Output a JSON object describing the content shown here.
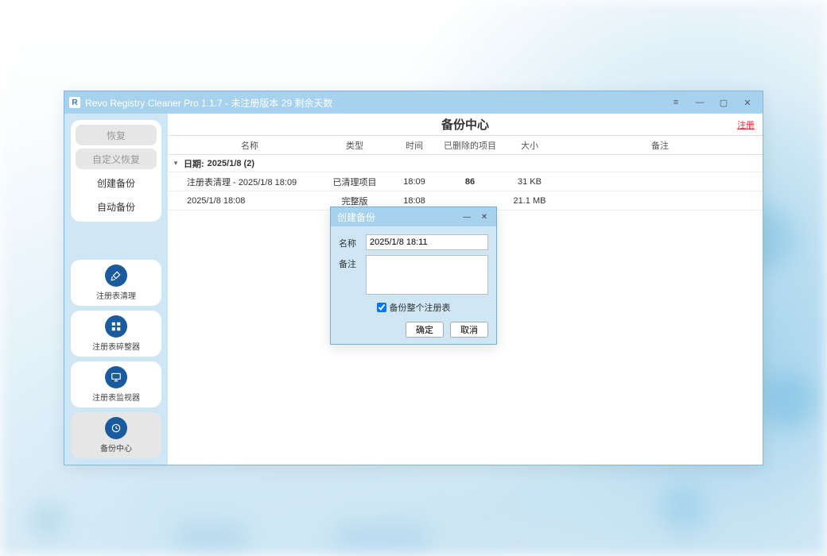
{
  "window": {
    "title": "Revo Registry Cleaner Pro 1.1.7 - 未注册版本 29 剩余天数"
  },
  "sidebar_top": {
    "restore": "恢复",
    "custom_restore": "自定义恢复",
    "create_backup": "创建备份",
    "auto_backup": "自动备份"
  },
  "nav": {
    "cleaner": "注册表清理",
    "defrag": "注册表碎整器",
    "monitor": "注册表监视器",
    "backup": "备份中心"
  },
  "main": {
    "title": "备份中心",
    "register": "注册"
  },
  "columns": {
    "name": "名称",
    "type": "类型",
    "time": "时间",
    "deleted": "已删除的项目",
    "size": "大小",
    "note": "备注"
  },
  "group": {
    "label_prefix": "日期:",
    "label_value": "2025/1/8  (2)"
  },
  "rows": [
    {
      "name": "注册表清理 - 2025/1/8 18:09",
      "type": "已清理项目",
      "time": "18:09",
      "deleted": "86",
      "size": "31 KB"
    },
    {
      "name": "2025/1/8 18:08",
      "type": "完整版",
      "time": "18:08",
      "deleted": "",
      "size": "21.1 MB"
    }
  ],
  "dialog": {
    "title": "创建备份",
    "name_label": "名称",
    "name_value": "2025/1/8 18:11",
    "note_label": "备注",
    "checkbox": "备份整个注册表",
    "ok": "确定",
    "cancel": "取消"
  }
}
